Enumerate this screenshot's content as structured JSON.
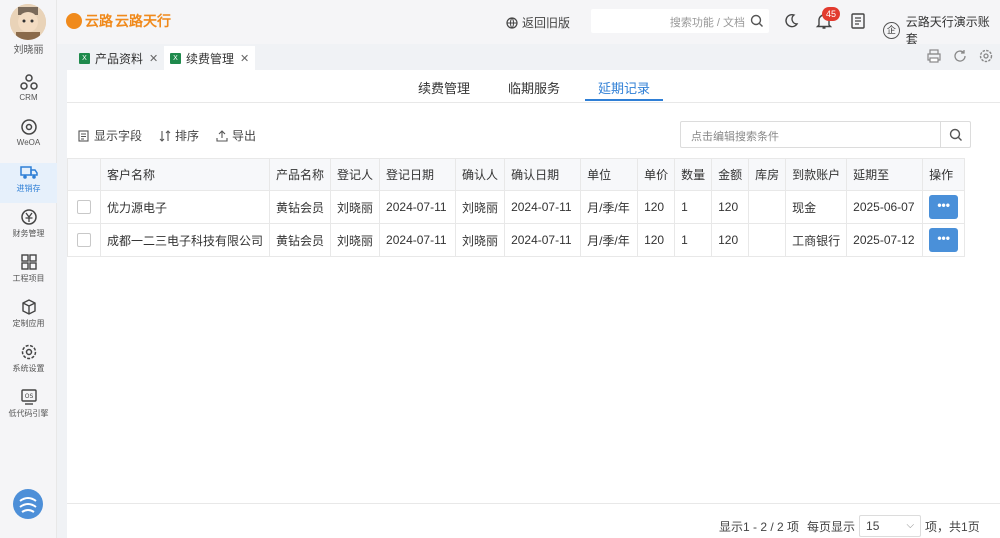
{
  "user": {
    "name": "刘晓丽"
  },
  "nav": [
    {
      "label": "CRM",
      "icon": "crm-icon"
    },
    {
      "label": "WeOA",
      "icon": "oa-icon"
    },
    {
      "label": "进销存",
      "icon": "truck-icon"
    },
    {
      "label": "财务管理",
      "icon": "money-icon"
    },
    {
      "label": "工程项目",
      "icon": "grid-icon"
    },
    {
      "label": "定制应用",
      "icon": "box-icon"
    },
    {
      "label": "系统设置",
      "icon": "gear-icon"
    },
    {
      "label": "低代码引擎",
      "icon": "os-icon"
    }
  ],
  "header": {
    "logo_en": "云路",
    "logo_cn": "云路天行",
    "old_version": "返回旧版",
    "search_placeholder": "搜索功能 / 文档",
    "notification_count": "45",
    "account": "云路天行演示账套",
    "account_mark": "企"
  },
  "tabs": [
    {
      "label": "产品资料"
    },
    {
      "label": "续费管理"
    }
  ],
  "subtabs": [
    {
      "label": "续费管理"
    },
    {
      "label": "临期服务"
    },
    {
      "label": "延期记录"
    }
  ],
  "toolbar": {
    "fields": "显示字段",
    "sort": "排序",
    "export": "导出",
    "search_placeholder": "点击编辑搜索条件"
  },
  "table": {
    "headers": [
      "客户名称",
      "产品名称",
      "登记人",
      "登记日期",
      "确认人",
      "确认日期",
      "单位",
      "单价",
      "数量",
      "金额",
      "库房",
      "到款账户",
      "延期至",
      "操作"
    ],
    "rows": [
      [
        "优力源电子",
        "黄钻会员",
        "刘晓丽",
        "2024-07-11",
        "刘晓丽",
        "2024-07-11",
        "月/季/年",
        "120",
        "1",
        "120",
        "",
        "现金",
        "2025-06-07"
      ],
      [
        "成都一二三电子科技有限公司",
        "黄钻会员",
        "刘晓丽",
        "2024-07-11",
        "刘晓丽",
        "2024-07-11",
        "月/季/年",
        "120",
        "1",
        "120",
        "",
        "工商银行",
        "2025-07-12"
      ]
    ],
    "more_label": "•••"
  },
  "pagination": {
    "summary": "显示1 - 2 / 2 项",
    "per_page_label": "每页显示",
    "per_page": "15",
    "total": "项，共1页"
  }
}
